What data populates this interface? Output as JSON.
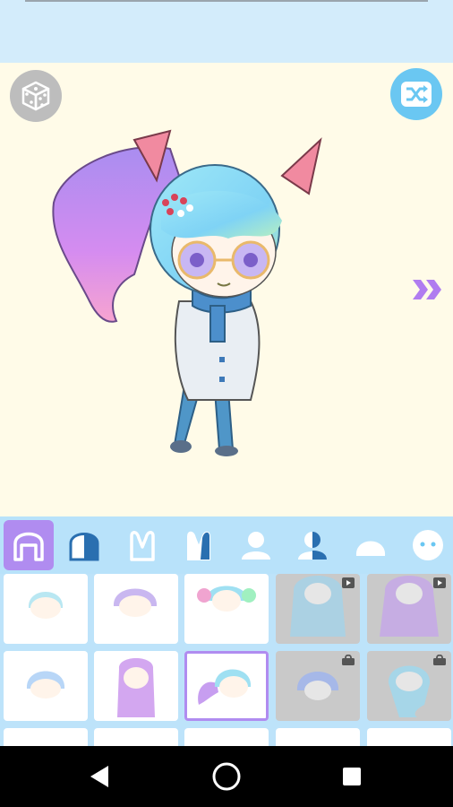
{
  "app": {
    "accent": "#b08cf0",
    "stage_bg": "#fffbe8",
    "toolbar_bg": "#b8e2fa"
  },
  "stage": {
    "dice_icon": "dice-icon",
    "shuffle_icon": "shuffle-icon",
    "next_icon": "double-chevron-right-icon"
  },
  "categories": [
    {
      "name": "hair-front",
      "active": true
    },
    {
      "name": "hair-back",
      "active": false
    },
    {
      "name": "ears",
      "active": false
    },
    {
      "name": "ears-alt",
      "active": false
    },
    {
      "name": "body",
      "active": false
    },
    {
      "name": "body-alt",
      "active": false
    },
    {
      "name": "head-shape",
      "active": false
    },
    {
      "name": "face",
      "active": false
    }
  ],
  "hair_items": [
    {
      "row": 1,
      "col": 1,
      "locked": false,
      "video": false,
      "selected": false
    },
    {
      "row": 1,
      "col": 2,
      "locked": false,
      "video": false,
      "selected": false
    },
    {
      "row": 1,
      "col": 3,
      "locked": false,
      "video": false,
      "selected": false
    },
    {
      "row": 1,
      "col": 4,
      "locked": true,
      "video": true,
      "selected": false
    },
    {
      "row": 1,
      "col": 5,
      "locked": true,
      "video": true,
      "selected": false
    },
    {
      "row": 2,
      "col": 1,
      "locked": false,
      "video": false,
      "selected": false
    },
    {
      "row": 2,
      "col": 2,
      "locked": false,
      "video": false,
      "selected": false
    },
    {
      "row": 2,
      "col": 3,
      "locked": false,
      "video": false,
      "selected": true
    },
    {
      "row": 2,
      "col": 4,
      "locked": true,
      "video": false,
      "selected": false
    },
    {
      "row": 2,
      "col": 5,
      "locked": true,
      "video": false,
      "selected": false
    }
  ],
  "nav": {
    "back_icon": "back-triangle-icon",
    "home_icon": "home-circle-icon",
    "recents_icon": "recents-square-icon"
  }
}
